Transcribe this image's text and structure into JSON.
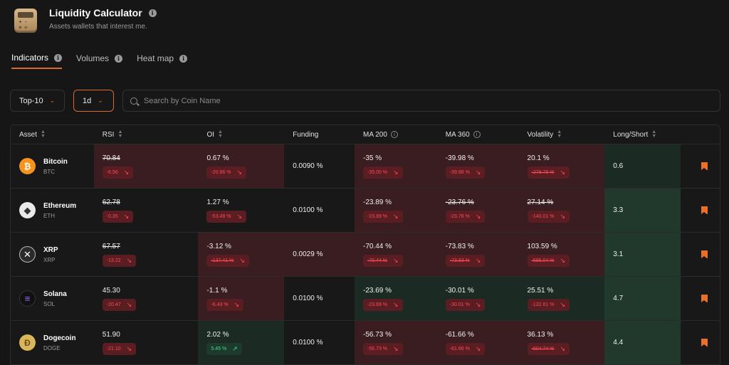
{
  "app": {
    "title": "Liquidity Calculator",
    "subtitle": "Assets wallets that interest me."
  },
  "tabs": [
    {
      "label": "Indicators",
      "active": true
    },
    {
      "label": "Volumes",
      "active": false
    },
    {
      "label": "Heat map",
      "active": false
    }
  ],
  "filters": {
    "top_value": "Top-10",
    "period_value": "1d",
    "search_placeholder": "Search by Coin Name"
  },
  "columns": [
    "Asset",
    "RSI",
    "OI",
    "Funding",
    "MA 200",
    "MA 360",
    "Volatility",
    "Long/Short"
  ],
  "colors": {
    "accent": "#d96a2a",
    "negative": "#ff4a5a",
    "positive": "#4bd58c",
    "bg_red": "#3a1d20",
    "bg_green": "#1c2a24"
  },
  "rows": [
    {
      "name": "Bitcoin",
      "symbol": "BTC",
      "icon": "bitcoin-icon",
      "rsi": "70.84",
      "rsi_change": "-6.56",
      "oi": "0.67 %",
      "oi_change": "-20.86 %",
      "funding": "0.0090 %",
      "ma200": "-35 %",
      "ma200_change": "-35.00 %",
      "ma360": "-39.98 %",
      "ma360_change": "-39.98 %",
      "volatility": "20.1 %",
      "volatility_change": "-279.78 %",
      "long_short": "0.6"
    },
    {
      "name": "Ethereum",
      "symbol": "ETH",
      "icon": "ethereum-icon",
      "rsi": "62.78",
      "rsi_change": "-0.35",
      "oi": "1.27 %",
      "oi_change": "-53.49 %",
      "funding": "0.0100 %",
      "ma200": "-23.89 %",
      "ma200_change": "-23.89 %",
      "ma360": "-23.76 %",
      "ma360_change": "-23.76 %",
      "volatility": "27.14 %",
      "volatility_change": "-140.01 %",
      "long_short": "3.3"
    },
    {
      "name": "XRP",
      "symbol": "XRP",
      "icon": "xrp-icon",
      "rsi": "67.57",
      "rsi_change": "-13.22",
      "oi": "-3.12 %",
      "oi_change": "-137.41 %",
      "funding": "0.0029 %",
      "ma200": "-70.44 %",
      "ma200_change": "-70.44 %",
      "ma360": "-73.83 %",
      "ma360_change": "-73.83 %",
      "volatility": "103.59 %",
      "volatility_change": "-695.04 %",
      "long_short": "3.1"
    },
    {
      "name": "Solana",
      "symbol": "SOL",
      "icon": "solana-icon",
      "rsi": "45.30",
      "rsi_change": "-20.47",
      "oi": "-1.1 %",
      "oi_change": "-6.43 %",
      "funding": "0.0100 %",
      "ma200": "-23.69 %",
      "ma200_change": "-23.69 %",
      "ma360": "-30.01 %",
      "ma360_change": "-30.01 %",
      "volatility": "25.51 %",
      "volatility_change": "-132.61 %",
      "long_short": "4.7"
    },
    {
      "name": "Dogecoin",
      "symbol": "DOGE",
      "icon": "dogecoin-icon",
      "rsi": "51.90",
      "rsi_change": "-21.10",
      "oi": "2.02 %",
      "oi_change": "5.45 %",
      "funding": "0.0100 %",
      "ma200": "-56.73 %",
      "ma200_change": "-56.73 %",
      "ma360": "-61.66 %",
      "ma360_change": "-61.66 %",
      "volatility": "36.13 %",
      "volatility_change": "-604.74 %",
      "long_short": "4.4"
    }
  ]
}
